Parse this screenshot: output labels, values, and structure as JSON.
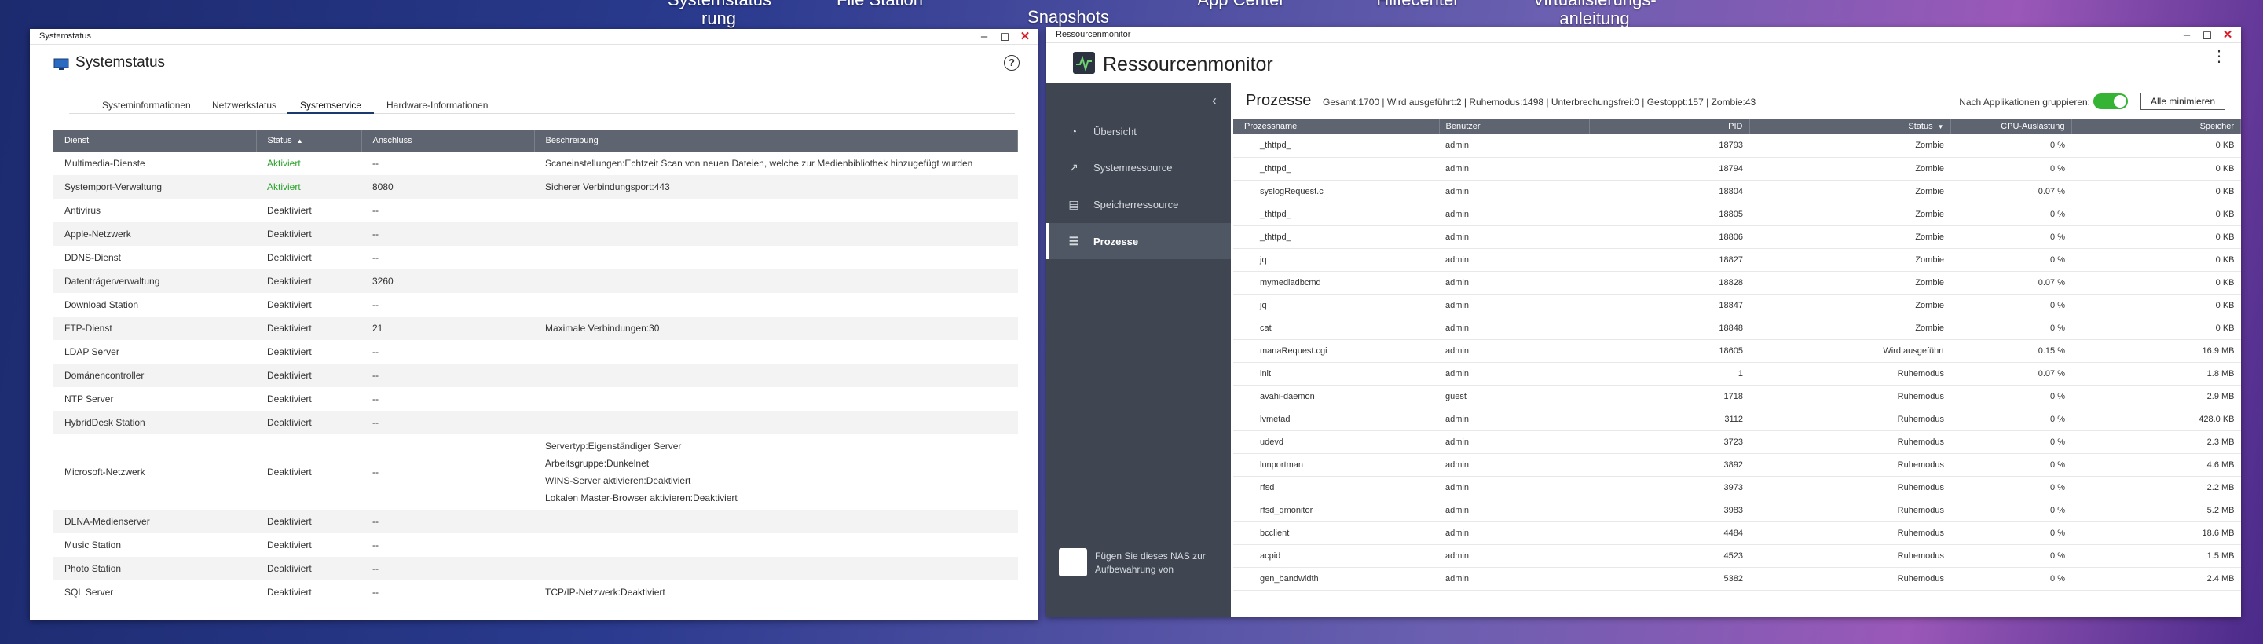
{
  "desktop": {
    "labels": [
      "Systemstatus\nrung",
      "File Station",
      "Snapshots",
      "App Center",
      "Hilfecenter",
      "Virtualisierungs-\nanleitung"
    ]
  },
  "systemstatus": {
    "window_title": "Systemstatus",
    "app_title": "Systemstatus",
    "help": "?",
    "tabs": [
      "Systeminformationen",
      "Netzwerkstatus",
      "Systemservice",
      "Hardware-Informationen"
    ],
    "columns": [
      "Dienst",
      "Status",
      "Anschluss",
      "Beschreibung"
    ],
    "rows": [
      {
        "dienst": "Multimedia-Dienste",
        "status": "Aktiviert",
        "anschluss": "--",
        "beschreibung": [
          "Scaneinstellungen:Echtzeit Scan von neuen Dateien, welche zur Medienbibliothek hinzugefügt wurden"
        ]
      },
      {
        "dienst": "Systemport-Verwaltung",
        "status": "Aktiviert",
        "anschluss": "8080",
        "beschreibung": [
          "Sicherer Verbindungsport:443"
        ]
      },
      {
        "dienst": "Antivirus",
        "status": "Deaktiviert",
        "anschluss": "--",
        "beschreibung": []
      },
      {
        "dienst": "Apple-Netzwerk",
        "status": "Deaktiviert",
        "anschluss": "--",
        "beschreibung": []
      },
      {
        "dienst": "DDNS-Dienst",
        "status": "Deaktiviert",
        "anschluss": "--",
        "beschreibung": []
      },
      {
        "dienst": "Datenträgerverwaltung",
        "status": "Deaktiviert",
        "anschluss": "3260",
        "beschreibung": []
      },
      {
        "dienst": "Download Station",
        "status": "Deaktiviert",
        "anschluss": "--",
        "beschreibung": []
      },
      {
        "dienst": "FTP-Dienst",
        "status": "Deaktiviert",
        "anschluss": "21",
        "beschreibung": [
          "Maximale Verbindungen:30"
        ]
      },
      {
        "dienst": "LDAP Server",
        "status": "Deaktiviert",
        "anschluss": "--",
        "beschreibung": []
      },
      {
        "dienst": "Domänencontroller",
        "status": "Deaktiviert",
        "anschluss": "--",
        "beschreibung": []
      },
      {
        "dienst": "NTP Server",
        "status": "Deaktiviert",
        "anschluss": "--",
        "beschreibung": []
      },
      {
        "dienst": "HybridDesk Station",
        "status": "Deaktiviert",
        "anschluss": "--",
        "beschreibung": []
      },
      {
        "dienst": "Microsoft-Netzwerk",
        "status": "Deaktiviert",
        "anschluss": "--",
        "beschreibung": [
          "Servertyp:Eigenständiger Server",
          "Arbeitsgruppe:Dunkelnet",
          "WINS-Server aktivieren:Deaktiviert",
          "Lokalen Master-Browser aktivieren:Deaktiviert"
        ]
      },
      {
        "dienst": "DLNA-Medienserver",
        "status": "Deaktiviert",
        "anschluss": "--",
        "beschreibung": []
      },
      {
        "dienst": "Music Station",
        "status": "Deaktiviert",
        "anschluss": "--",
        "beschreibung": []
      },
      {
        "dienst": "Photo Station",
        "status": "Deaktiviert",
        "anschluss": "--",
        "beschreibung": []
      },
      {
        "dienst": "SQL Server",
        "status": "Deaktiviert",
        "anschluss": "--",
        "beschreibung": [
          "TCP/IP-Netzwerk:Deaktiviert"
        ]
      }
    ]
  },
  "ressourcenmonitor": {
    "window_title": "Ressourcenmonitor",
    "app_title": "Ressourcenmonitor",
    "sidebar": [
      "Übersicht",
      "Systemressource",
      "Speicherressource",
      "Prozesse"
    ],
    "footer_text": "Fügen Sie dieses NAS zur Aufbewahrung von",
    "section_title": "Prozesse",
    "stats": "Gesamt:1700 | Wird ausgeführt:2 | Ruhemodus:1498 | Unterbrechungsfrei:0 | Gestoppt:157 | Zombie:43",
    "group_label": "Nach Applikationen gruppieren:",
    "minimize_button": "Alle minimieren",
    "columns": [
      "Prozessname",
      "Benutzer",
      "PID",
      "Status",
      "CPU-Auslastung",
      "Speicher"
    ],
    "rows": [
      [
        "_thttpd_",
        "admin",
        "18793",
        "Zombie",
        "0 %",
        "0 KB"
      ],
      [
        "_thttpd_",
        "admin",
        "18794",
        "Zombie",
        "0 %",
        "0 KB"
      ],
      [
        "syslogRequest.c",
        "admin",
        "18804",
        "Zombie",
        "0.07 %",
        "0 KB"
      ],
      [
        "_thttpd_",
        "admin",
        "18805",
        "Zombie",
        "0 %",
        "0 KB"
      ],
      [
        "_thttpd_",
        "admin",
        "18806",
        "Zombie",
        "0 %",
        "0 KB"
      ],
      [
        "jq",
        "admin",
        "18827",
        "Zombie",
        "0 %",
        "0 KB"
      ],
      [
        "mymediadbcmd",
        "admin",
        "18828",
        "Zombie",
        "0.07 %",
        "0 KB"
      ],
      [
        "jq",
        "admin",
        "18847",
        "Zombie",
        "0 %",
        "0 KB"
      ],
      [
        "cat",
        "admin",
        "18848",
        "Zombie",
        "0 %",
        "0 KB"
      ],
      [
        "manaRequest.cgi",
        "admin",
        "18605",
        "Wird ausgeführt",
        "0.15 %",
        "16.9 MB"
      ],
      [
        "init",
        "admin",
        "1",
        "Ruhemodus",
        "0.07 %",
        "1.8 MB"
      ],
      [
        "avahi-daemon",
        "guest",
        "1718",
        "Ruhemodus",
        "0 %",
        "2.9 MB"
      ],
      [
        "lvmetad",
        "admin",
        "3112",
        "Ruhemodus",
        "0 %",
        "428.0 KB"
      ],
      [
        "udevd",
        "admin",
        "3723",
        "Ruhemodus",
        "0 %",
        "2.3 MB"
      ],
      [
        "lunportman",
        "admin",
        "3892",
        "Ruhemodus",
        "0 %",
        "4.6 MB"
      ],
      [
        "rfsd",
        "admin",
        "3973",
        "Ruhemodus",
        "0 %",
        "2.2 MB"
      ],
      [
        "rfsd_qmonitor",
        "admin",
        "3983",
        "Ruhemodus",
        "0 %",
        "5.2 MB"
      ],
      [
        "bcclient",
        "admin",
        "4484",
        "Ruhemodus",
        "0 %",
        "18.6 MB"
      ],
      [
        "acpid",
        "admin",
        "4523",
        "Ruhemodus",
        "0 %",
        "1.5 MB"
      ],
      [
        "gen_bandwidth",
        "admin",
        "5382",
        "Ruhemodus",
        "0 %",
        "2.4 MB"
      ]
    ]
  }
}
